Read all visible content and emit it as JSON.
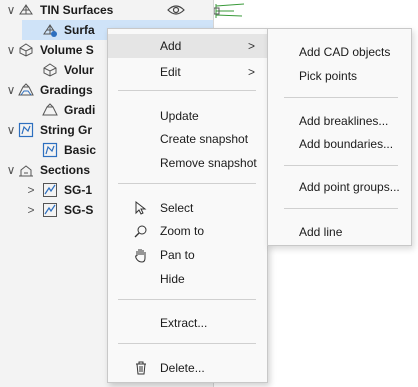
{
  "tree": {
    "rows": [
      {
        "label": "TIN Surfaces"
      },
      {
        "label": "Surfa"
      },
      {
        "label": "Volume S"
      },
      {
        "label": "Volur"
      },
      {
        "label": "Gradings"
      },
      {
        "label": "Gradi"
      },
      {
        "label": "String Gr"
      },
      {
        "label": "Basic"
      },
      {
        "label": "Sections"
      },
      {
        "label": "SG-1"
      },
      {
        "label": "SG-S"
      }
    ]
  },
  "context_menu": {
    "items": {
      "add": "Add",
      "edit": "Edit",
      "update": "Update",
      "create_snapshot": "Create snapshot",
      "remove_snapshot": "Remove snapshot",
      "select": "Select",
      "zoom_to": "Zoom to",
      "pan_to": "Pan to",
      "hide": "Hide",
      "extract": "Extract...",
      "delete": "Delete..."
    },
    "highlighted": "Add"
  },
  "submenu": {
    "items": {
      "add_cad_objects": "Add CAD objects",
      "pick_points": "Pick points",
      "add_breaklines": "Add breaklines...",
      "add_boundaries": "Add boundaries...",
      "add_point_groups": "Add point groups...",
      "add_line": "Add line"
    }
  },
  "icons": {
    "tin": "tin-surface-icon",
    "volume": "volume-surface-icon",
    "grading": "grading-icon",
    "string": "string-group-icon",
    "section": "section-icon",
    "eye": "eye-icon",
    "select": "cursor-icon",
    "zoom": "magnifier-icon",
    "pan": "hand-icon",
    "delete": "trash-icon"
  },
  "colors": {
    "icon_blue": "#2d6fbf",
    "selection": "#cfe3f8",
    "menu_highlight": "#e5e5e5"
  }
}
